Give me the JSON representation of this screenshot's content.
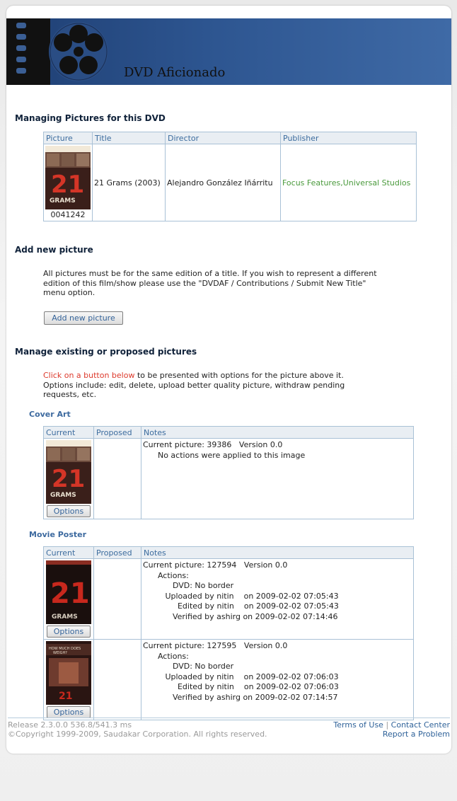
{
  "header": {
    "brand": "DVD Aficionado"
  },
  "section1": {
    "title": "Managing Pictures for this DVD",
    "columns": [
      "Picture",
      "Title",
      "Director",
      "Publisher"
    ],
    "row": {
      "picture_id": "0041242",
      "title": "21 Grams (2003)",
      "director": "Alejandro González Iñárritu",
      "publisher": "Focus Features,Universal Studios"
    }
  },
  "section2": {
    "title": "Add new picture",
    "text": "All pictures must be for the same edition of a title. If you wish to represent a different edition of this film/show please use the \"DVDAF / Contributions / Submit New Title\" menu option.",
    "button": "Add new picture"
  },
  "section3": {
    "title": "Manage existing or proposed pictures",
    "hint_red": "Click on a button below",
    "hint_rest": " to be presented with options for the picture above it. Options include: edit, delete, upload better quality picture, withdraw pending requests, etc.",
    "columns": [
      "Current",
      "Proposed",
      "Notes"
    ],
    "option_label": "Options"
  },
  "cover_art": {
    "title": "Cover Art",
    "rows": [
      {
        "notes": "Current picture: 39386   Version 0.0\n      No actions were applied to this image"
      }
    ]
  },
  "movie_poster": {
    "title": "Movie Poster",
    "rows": [
      {
        "notes": "Current picture: 127594   Version 0.0\n      Actions:\n            DVD: No border\n         Uploaded by nitin    on 2009-02-02 07:05:43\n              Edited by nitin    on 2009-02-02 07:05:43\n            Verified by ashirg on 2009-02-02 07:14:46"
      },
      {
        "notes": "Current picture: 127595   Version 0.0\n      Actions:\n            DVD: No border\n         Uploaded by nitin    on 2009-02-02 07:06:03\n              Edited by nitin    on 2009-02-02 07:06:03\n            Verified by ashirg on 2009-02-02 07:14:57"
      }
    ]
  },
  "footer": {
    "release": "Release 2.3.0.0   536.8/541.3 ms",
    "copyright": "©Copyright 1999-2009, Saudakar Corporation. All rights reserved.",
    "terms": "Terms of Use",
    "separator": "|",
    "contact": "Contact Center",
    "report": "Report a Problem"
  },
  "colors": {
    "link": "#3c6c9e",
    "publisher": "#4a9a3c",
    "hint": "#dd3a2c",
    "banner": "#2d5590"
  }
}
